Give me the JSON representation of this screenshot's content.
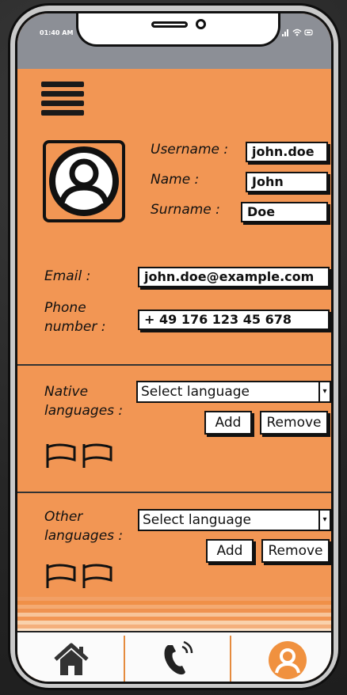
{
  "status_bar": {
    "time": "01:40 AM"
  },
  "profile": {
    "username_label": "Username :",
    "username_value": "john.doe",
    "name_label": "Name :",
    "name_value": "John",
    "surname_label": "Surname :",
    "surname_value": "Doe"
  },
  "contact": {
    "email_label": "Email :",
    "email_value": "john.doe@example.com",
    "phone_label_line1": "Phone",
    "phone_label_line2": "number :",
    "phone_value": "+ 49 176 123 45 678"
  },
  "native_languages": {
    "label_line1": "Native",
    "label_line2": "languages :",
    "select_value": "Select language",
    "add_label": "Add",
    "remove_label": "Remove",
    "flag_count": 2
  },
  "other_languages": {
    "label_line1": "Other",
    "label_line2": "languages :",
    "select_value": "Select language",
    "add_label": "Add",
    "remove_label": "Remove",
    "flag_count": 2
  },
  "bottom_nav": {
    "items": [
      {
        "icon": "home-icon"
      },
      {
        "icon": "phone-call-icon"
      },
      {
        "icon": "profile-icon",
        "active": true
      }
    ]
  },
  "colors": {
    "screen_bg": "#f29654",
    "status_bar": "#8c8f96",
    "accent": "#f0913f"
  }
}
